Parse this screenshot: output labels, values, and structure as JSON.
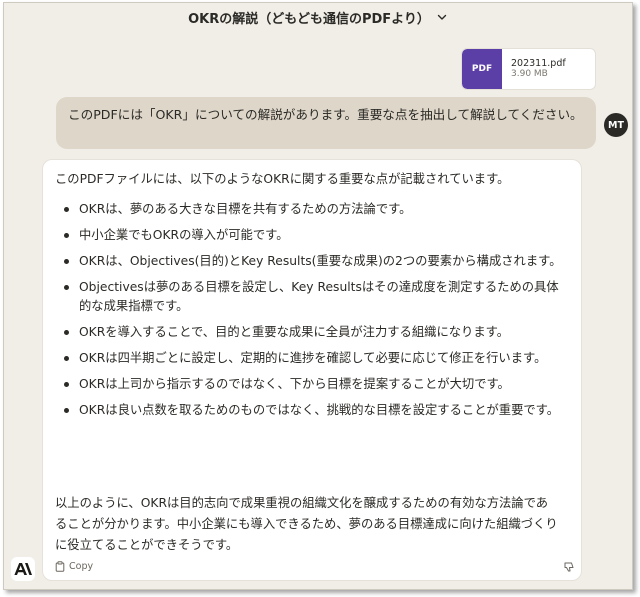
{
  "header": {
    "title": "OKRの解説（どもども通信のPDFより）",
    "chevron_icon": "chevron-down-icon"
  },
  "attachment": {
    "thumb_label": "PDF",
    "file_name": "202311.pdf",
    "file_size": "3.90 MB"
  },
  "user_message": {
    "text": "このPDFには「OKR」についての解説があります。重要な点を抽出して解説してください。",
    "avatar_initials": "MT"
  },
  "assistant_message": {
    "intro": "このPDFファイルには、以下のようなOKRに関する重要な点が記載されています。",
    "bullets": [
      "OKRは、夢のある大きな目標を共有するための方法論です。",
      "中小企業でもOKRの導入が可能です。",
      "OKRは、Objectives(目的)とKey Results(重要な成果)の2つの要素から構成されます。",
      "Objectivesは夢のある目標を設定し、Key Resultsはその達成度を測定するための具体的な成果指標です。",
      "OKRを導入することで、目的と重要な成果に全員が注力する組織になります。",
      "OKRは四半期ごとに設定し、定期的に進捗を確認して必要に応じて修正を行います。",
      "OKRは上司から指示するのではなく、下から目標を提案することが大切です。",
      "OKRは良い点数を取るためのものではなく、挑戦的な目標を設定することが重要です。"
    ],
    "conclusion": "以上のように、OKRは目的志向で成果重視の組織文化を醸成するための有効な方法論であることが分かります。中小企業にも導入できるため、夢のある目標達成に向けた組織づくりに役立てることができそうです。",
    "copy_label": "Copy",
    "copy_icon": "clipboard-icon",
    "feedback_icon": "thumbs-down-icon",
    "avatar_icon": "anthropic-logo-icon"
  },
  "colors": {
    "background": "#f1eee7",
    "user_bubble": "#ddd6c9",
    "pdf_thumb": "#5b3fa6",
    "text": "#2b2a26"
  }
}
